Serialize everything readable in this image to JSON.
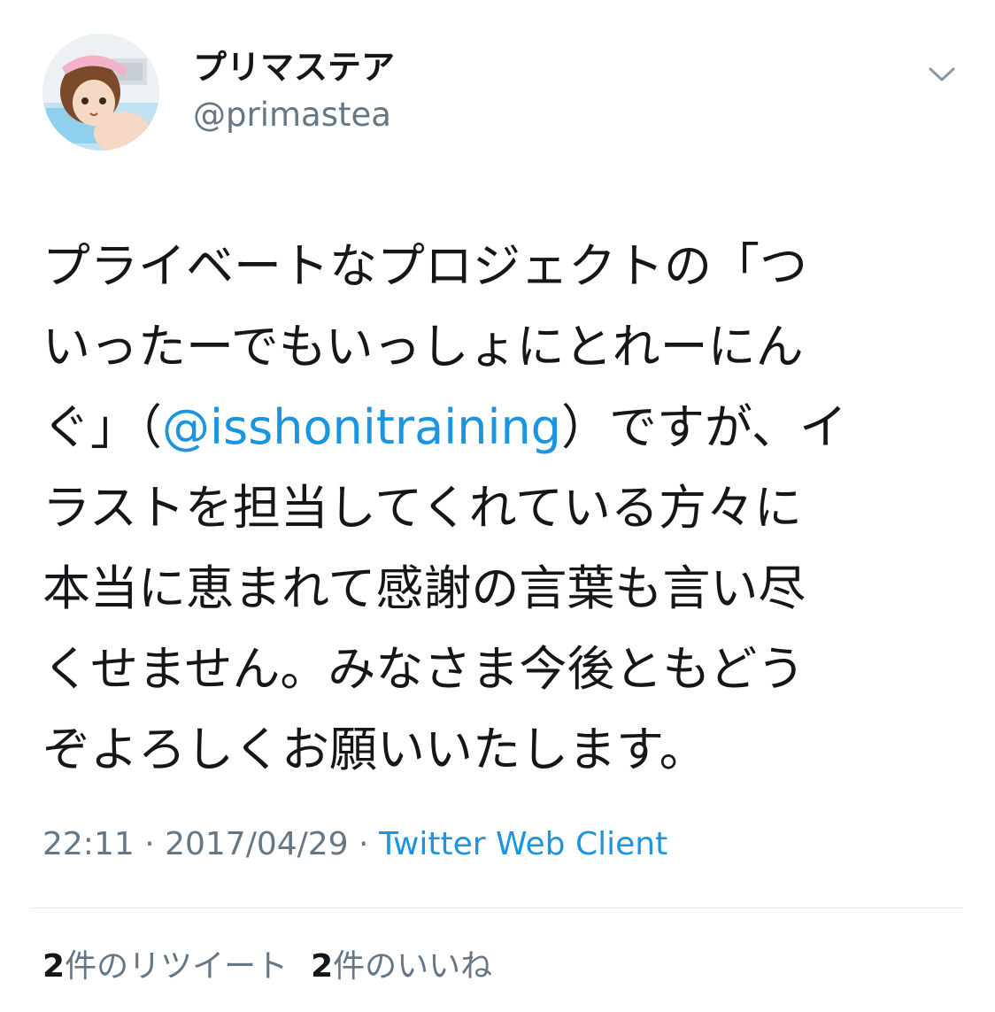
{
  "tweet": {
    "display_name": "プリマステア",
    "handle": "@primastea",
    "menu_icon": "chevron-down-icon",
    "avatar_icon": "avatar",
    "text_lines": [
      {
        "before": "プライベートなプロジェクトの「つ",
        "mention": "",
        "after": ""
      },
      {
        "before": "いったーでもいっしょにとれーにん",
        "mention": "",
        "after": ""
      },
      {
        "before": "ぐ」（",
        "mention": "@isshonitraining",
        "after": "）ですが、イ"
      },
      {
        "before": "ラストを担当してくれている方々に",
        "mention": "",
        "after": ""
      },
      {
        "before": "本当に恵まれて感謝の言葉も言い尽",
        "mention": "",
        "after": ""
      },
      {
        "before": "くせません。みなさま今後ともどう",
        "mention": "",
        "after": ""
      },
      {
        "before": "ぞよろしくお願いいたします。",
        "mention": "",
        "after": ""
      }
    ],
    "time": "22:11",
    "separator": " · ",
    "date": "2017/04/29",
    "source": "Twitter Web Client",
    "retweets": {
      "count": "2",
      "label": "件のリツイート"
    },
    "likes": {
      "count": "2",
      "label": "件のいいね"
    }
  },
  "colors": {
    "text": "#14171a",
    "secondary": "#657786",
    "link": "#1b95e0",
    "divider": "#e1e8ed"
  }
}
